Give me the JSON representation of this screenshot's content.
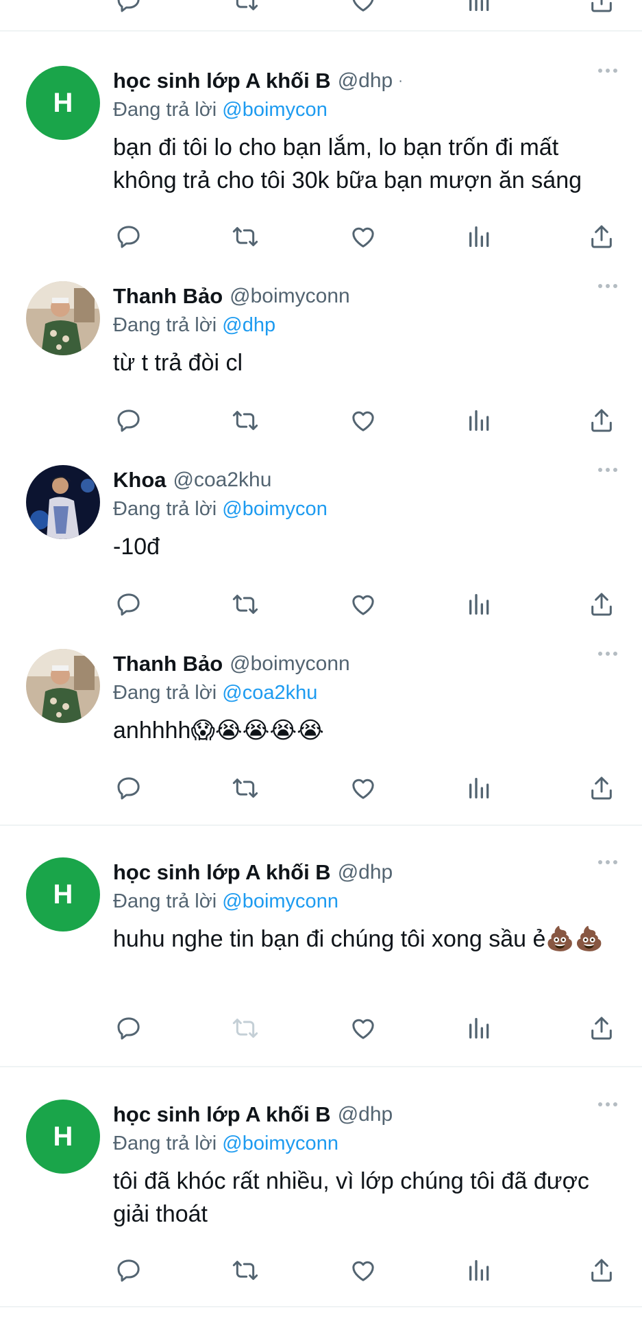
{
  "reply_prefix": "Đang trả lời",
  "tweets": [
    {
      "name": "học sinh lớp A khối B",
      "handle": "@dhp",
      "reply_to": "@boimycon",
      "text": "bạn đi tôi lo cho bạn lắm, lo bạn trốn đi mất không trả cho tôi 30k bữa bạn mượn ăn sáng",
      "avatar": "H"
    },
    {
      "name": "Thanh Bảo",
      "handle": "@boimyconn",
      "reply_to": "@dhp",
      "text": "từ t trả đòi cl"
    },
    {
      "name": "Khoa",
      "handle": "@coa2khu",
      "reply_to": "@boimycon",
      "text": "-10đ"
    },
    {
      "name": "Thanh Bảo",
      "handle": "@boimyconn",
      "reply_to": "@coa2khu",
      "text": "anhhhh😱😭😭😭😭"
    },
    {
      "name": "học sinh lớp A khối B",
      "handle": "@dhp",
      "reply_to": "@boimyconn",
      "text": "huhu nghe tin bạn đi chúng tôi xong sầu ẻ💩💩",
      "avatar": "H"
    },
    {
      "name": "học sinh lớp A khối B",
      "handle": "@dhp",
      "reply_to": "@boimyconn",
      "text": "tôi đã khóc rất nhiều, vì lớp chúng tôi đã được giải thoát",
      "avatar": "H"
    }
  ],
  "icons": {
    "reply": "comment-icon",
    "retweet": "retweet-icon",
    "like": "heart-icon",
    "views": "views-chart-icon",
    "share": "share-icon",
    "more": "more-dots-icon"
  },
  "colors": {
    "avatar_green": "#1aa54a",
    "mention_blue": "#1d9bf0",
    "secondary_text": "#536471",
    "icon_gray": "#536471",
    "disabled_icon": "#c4cfd6"
  }
}
